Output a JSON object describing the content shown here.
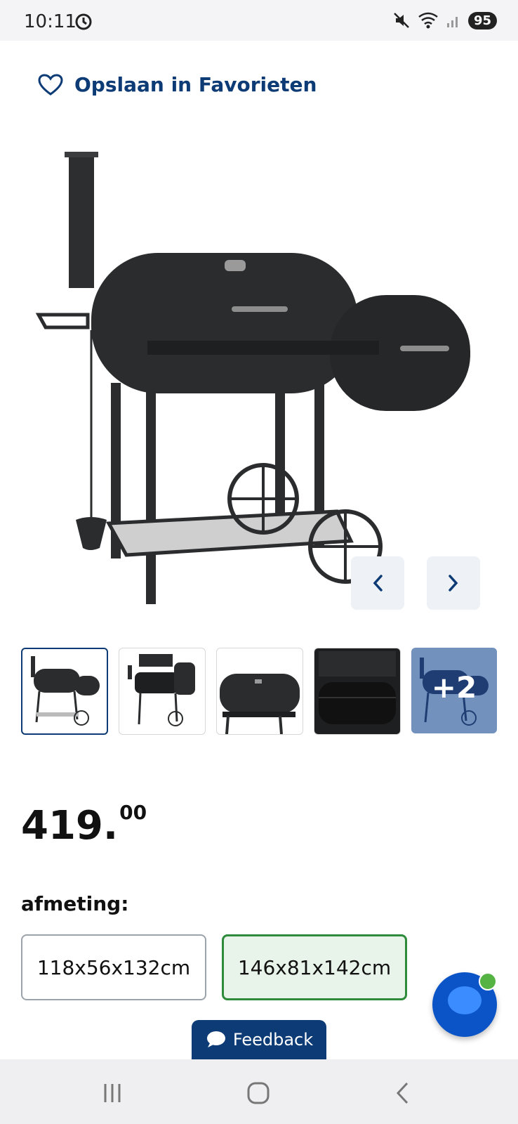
{
  "status_bar": {
    "time": "10:11",
    "battery": "95",
    "icons": [
      "sync-icon",
      "mute-icon",
      "wifi-icon",
      "signal-icon"
    ]
  },
  "favorite": {
    "label": "Opslaan in Favorieten",
    "icon": "heart-icon"
  },
  "gallery": {
    "main_image": "charcoal-smoker-grill",
    "thumbnails": [
      "thumb-1",
      "thumb-2",
      "thumb-3",
      "thumb-4"
    ],
    "more_label": "+2",
    "prev_icon": "chevron-left-icon",
    "next_icon": "chevron-right-icon"
  },
  "price": {
    "integer": "419.",
    "decimals": "00"
  },
  "size": {
    "label": "afmeting:",
    "options": [
      {
        "label": "118x56x132cm",
        "selected": false
      },
      {
        "label": "146x81x142cm",
        "selected": true
      }
    ]
  },
  "feedback": {
    "label": "Feedback",
    "icon": "chat-bubble-icon"
  },
  "chat_widget": {
    "icon": "chat-widget-icon",
    "status_color": "#54b343"
  },
  "nav": {
    "icons": [
      "recent-apps-icon",
      "home-icon",
      "back-icon"
    ]
  },
  "colors": {
    "brand": "#0d3b75",
    "selected_border": "#2e8b3c",
    "selected_bg": "#e8f4ea",
    "more_overlay": "#7391bd"
  }
}
